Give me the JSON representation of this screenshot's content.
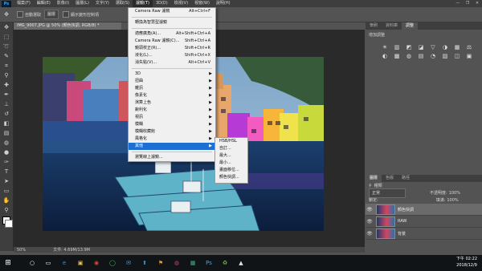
{
  "menubar": {
    "logo": "Ps",
    "items": [
      "檔案(F)",
      "編輯(E)",
      "影像(I)",
      "圖層(L)",
      "文字(Y)",
      "選取(S)",
      "濾鏡(T)",
      "3D(D)",
      "檢視(V)",
      "視窗(W)",
      "說明(H)"
    ],
    "active_index": 6
  },
  "window_controls": [
    "—",
    "❐",
    "✕"
  ],
  "options_bar": {
    "auto_select_label": "自動選取",
    "auto_select_value": "圖層",
    "show_transform_label": "顯示變形控制項"
  },
  "document": {
    "tab_title": "IMG_9007.JPG @ 50% (顏色快調, RGB/8) *"
  },
  "filter_menu": {
    "items": [
      {
        "label": "Camera Raw 濾鏡",
        "shortcut": "Alt+Ctrl+F"
      },
      {
        "sep": true
      },
      {
        "label": "轉換為智慧型濾鏡"
      },
      {
        "sep": true
      },
      {
        "label": "適應廣角(A)...",
        "shortcut": "Alt+Shift+Ctrl+A"
      },
      {
        "label": "Camera Raw 濾鏡(C)...",
        "shortcut": "Shift+Ctrl+A"
      },
      {
        "label": "鏡頭校正(R)...",
        "shortcut": "Shift+Ctrl+R"
      },
      {
        "label": "液化(L)...",
        "shortcut": "Shift+Ctrl+X"
      },
      {
        "label": "消失點(V)...",
        "shortcut": "Alt+Ctrl+V"
      },
      {
        "sep": true
      },
      {
        "label": "3D",
        "submenu": true
      },
      {
        "label": "扭曲",
        "submenu": true
      },
      {
        "label": "雜訊",
        "submenu": true
      },
      {
        "label": "像素化",
        "submenu": true
      },
      {
        "label": "演算上色",
        "submenu": true
      },
      {
        "label": "銳利化",
        "submenu": true
      },
      {
        "label": "視訊",
        "submenu": true
      },
      {
        "label": "模糊",
        "submenu": true
      },
      {
        "label": "模糊收藏館",
        "submenu": true
      },
      {
        "label": "風格化",
        "submenu": true
      },
      {
        "label": "其他",
        "submenu": true,
        "highlight": true
      },
      {
        "sep": true
      },
      {
        "label": "瀏覽線上濾鏡..."
      }
    ]
  },
  "sub_menu": {
    "items": [
      "HSB/HSL",
      "自訂...",
      "最大...",
      "最小...",
      "畫面移位...",
      "顏色快調..."
    ]
  },
  "right_panels": {
    "top_tabs": [
      "筆刷",
      "資料庫",
      "調整"
    ],
    "adjust_title": "增加調整",
    "adjust_icons": [
      "☀",
      "▥",
      "◩",
      "◪",
      "▽",
      "◑",
      "▦",
      "⚖",
      "◐",
      "▩",
      "◍",
      "▤",
      "◔",
      "▨",
      "◫",
      "▣"
    ],
    "layers_tabs": [
      "圖層",
      "色版",
      "路徑"
    ],
    "kind_label": "種類",
    "blend_mode": "正常",
    "opacity_label": "不透明度:",
    "opacity_value": "100%",
    "lock_label": "鎖定:",
    "fill_label": "填滿:",
    "fill_value": "100%",
    "layers": [
      {
        "name": "顏色快調",
        "selected": true
      },
      {
        "name": "RAW",
        "selected": false
      },
      {
        "name": "背景",
        "selected": false
      }
    ]
  },
  "status": {
    "zoom": "50%",
    "doc_size": "文件: 4.69M/13.9M"
  },
  "taskbar": {
    "start": "⊞",
    "icons": [
      "○",
      "▭",
      "e",
      "▣",
      "◉",
      "◯",
      "✉",
      "⬆",
      "⚑",
      "◍",
      "▦",
      "Ps",
      "♻",
      "▲"
    ],
    "time": "下午 02:22",
    "date": "2018/12/9"
  }
}
